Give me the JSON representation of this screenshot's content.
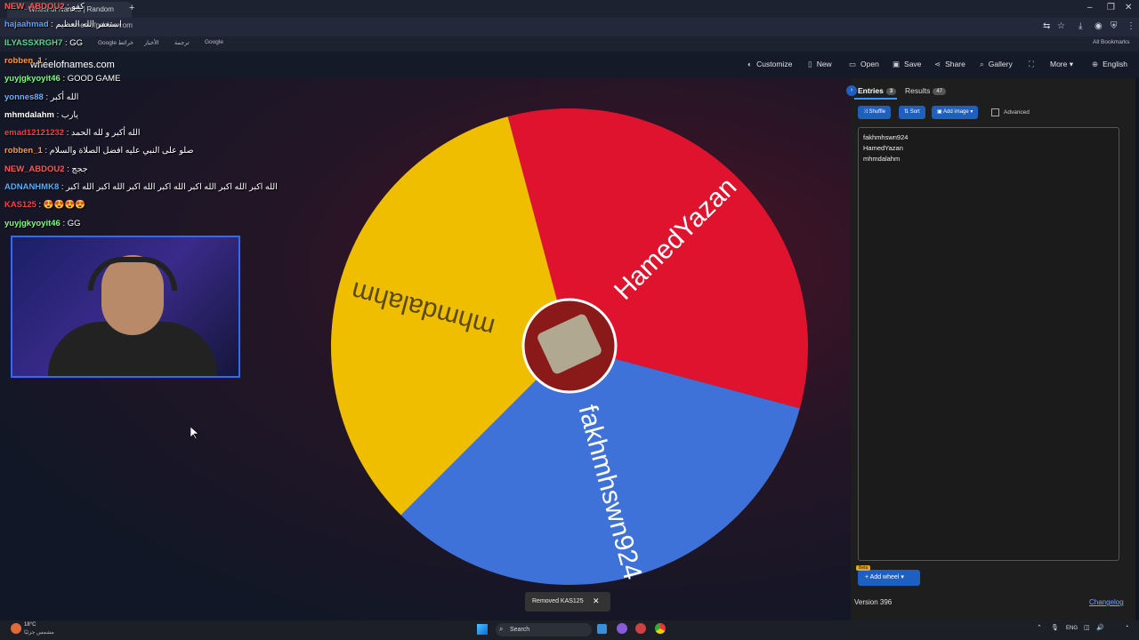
{
  "browser": {
    "tab_title": "Wheel of Names | Random",
    "url": "wheelofnames.com",
    "bookmarks": [
      "Google خرائط",
      "الأخبار",
      "ترجمة",
      "Google"
    ],
    "all_bookmarks": "All Bookmarks"
  },
  "app": {
    "logo": "wheelofnames.com",
    "nav": [
      "Customize",
      "New",
      "Open",
      "Save",
      "Share",
      "Gallery",
      "More",
      "English"
    ]
  },
  "wheel": {
    "segments": [
      {
        "label": "HamedYazan",
        "color": "#e0132f"
      },
      {
        "label": "fakhmhswn924",
        "color": "#3f72d9"
      },
      {
        "label": "mhmdalahm",
        "color": "#f0be00"
      }
    ]
  },
  "panel": {
    "entries_tab": "Entries",
    "entries_count": "3",
    "results_tab": "Results",
    "results_count": "47",
    "shuffle": "Shuffle",
    "sort": "Sort",
    "add_image": "Add image",
    "advanced": "Advanced",
    "entries": [
      "fakhmhswn924",
      "HamedYazan",
      "mhmdalahm"
    ],
    "beta": "Beta",
    "add_wheel": "Add wheel",
    "version": "Version 396",
    "changelog": "Changelog"
  },
  "toast": {
    "text": "Removed KAS125"
  },
  "chat": [
    {
      "user": "NEW_ABDOU2",
      "msg": ": كفو",
      "color": "#ff5a5a"
    },
    {
      "user": "hajaahmad",
      "msg": ": استغفر الله العظيم",
      "color": "#5aa0ff"
    },
    {
      "user": "ILYASSXRGH7",
      "msg": ": GG",
      "color": "#58d68d"
    },
    {
      "user": "robben_1",
      "msg": ": ",
      "color": "#ff9a3c"
    },
    {
      "user": "yuyjgkyoyit46",
      "msg": ": GOOD GAME",
      "color": "#7dff7d"
    },
    {
      "user": "yonnes88",
      "msg": ": الله أكبر",
      "color": "#6ab0ff"
    },
    {
      "user": "mhmdalahm",
      "msg": ": يارب",
      "color": "#ffffff"
    },
    {
      "user": "emad12121232",
      "msg": ": الله أكبر و لله الحمد",
      "color": "#ff3b3b"
    },
    {
      "user": "robben_1",
      "msg": ": صلو على النبي عليه افضل الصلاة والسلام",
      "color": "#ff9a3c"
    },
    {
      "user": "NEW_ABDOU2",
      "msg": ": ججج",
      "color": "#ff5a5a"
    },
    {
      "user": "ADNANHMK8",
      "msg": ": الله اكبر الله اكبر الله اكبر الله اكبر الله اكبر الله اكبر الله اكبر",
      "color": "#4fb0ff"
    },
    {
      "user": "KAS125",
      "msg": ": 😍😍😍😍",
      "color": "#ff4040"
    },
    {
      "user": "yuyjgkyoyit46",
      "msg": ": GG",
      "color": "#7dff7d"
    }
  ],
  "taskbar": {
    "weather_temp": "18°C",
    "weather_desc": "مشمس جزئيًا",
    "search": "Search",
    "lang": "ENG"
  }
}
